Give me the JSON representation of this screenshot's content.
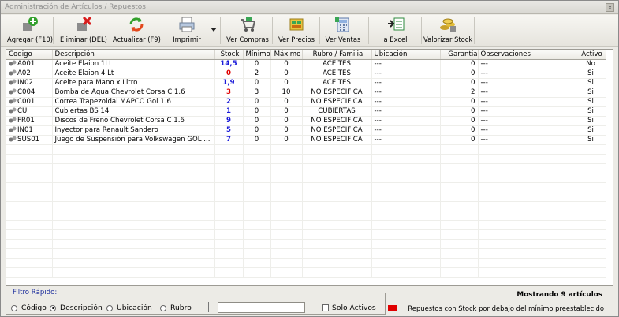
{
  "window": {
    "title": "Administración de Artículos / Repuestos",
    "close": "x"
  },
  "toolbar": {
    "add": "Agregar (F10)",
    "delete": "Eliminar (DEL)",
    "refresh": "Actualizar (F9)",
    "print": "Imprimir",
    "purchases": "Ver Compras",
    "prices": "Ver Precios",
    "sales": "Ver Ventas",
    "excel": "a Excel",
    "stock": "Valorizar Stock"
  },
  "table": {
    "headers": [
      "Codigo",
      "Descripción",
      "Stock",
      "Mínimo",
      "Máximo",
      "Rubro / Familia",
      "Ubicación",
      "Garantia",
      "Observaciones",
      "Activo"
    ],
    "rows": [
      {
        "code": "A001",
        "desc": "Aceite Elaion 1Lt",
        "stock": "14,5",
        "stock_color": "#1a1ad8",
        "min": "0",
        "max": "0",
        "rubro": "ACEITES",
        "ubic": "---",
        "gar": "0",
        "obs": "---",
        "activo": "No"
      },
      {
        "code": "A02",
        "desc": "Aceite Elaion 4 Lt",
        "stock": "0",
        "stock_color": "#e00000",
        "min": "2",
        "max": "0",
        "rubro": "ACEITES",
        "ubic": "---",
        "gar": "0",
        "obs": "---",
        "activo": "Si"
      },
      {
        "code": "IN02",
        "desc": "Aceite para Mano x Litro",
        "stock": "1,9",
        "stock_color": "#1a1ad8",
        "min": "0",
        "max": "0",
        "rubro": "ACEITES",
        "ubic": "---",
        "gar": "0",
        "obs": "---",
        "activo": "Si"
      },
      {
        "code": "C004",
        "desc": "Bomba de Agua Chevrolet Corsa C 1.6",
        "stock": "3",
        "stock_color": "#e00000",
        "min": "3",
        "max": "10",
        "rubro": "NO ESPECIFICA",
        "ubic": "---",
        "gar": "2",
        "obs": "---",
        "activo": "Si"
      },
      {
        "code": "C001",
        "desc": "Correa Trapezoidal MAPCO Gol 1.6",
        "stock": "2",
        "stock_color": "#1a1ad8",
        "min": "0",
        "max": "0",
        "rubro": "NO ESPECIFICA",
        "ubic": "---",
        "gar": "0",
        "obs": "---",
        "activo": "Si"
      },
      {
        "code": "CU",
        "desc": "Cubiertas BS 14",
        "stock": "1",
        "stock_color": "#1a1ad8",
        "min": "0",
        "max": "0",
        "rubro": "CUBIERTAS",
        "ubic": "---",
        "gar": "0",
        "obs": "---",
        "activo": "Si"
      },
      {
        "code": "FR01",
        "desc": "Discos de Freno Chevrolet Corsa C 1.6",
        "stock": "9",
        "stock_color": "#1a1ad8",
        "min": "0",
        "max": "0",
        "rubro": "NO ESPECIFICA",
        "ubic": "---",
        "gar": "0",
        "obs": "---",
        "activo": "Si"
      },
      {
        "code": "IN01",
        "desc": "Inyector para Renault Sandero",
        "stock": "5",
        "stock_color": "#1a1ad8",
        "min": "0",
        "max": "0",
        "rubro": "NO ESPECIFICA",
        "ubic": "---",
        "gar": "0",
        "obs": "---",
        "activo": "Si"
      },
      {
        "code": "SUS01",
        "desc": "Juego de Suspensión para Volkswagen GOL ...",
        "stock": "7",
        "stock_color": "#1a1ad8",
        "min": "0",
        "max": "0",
        "rubro": "NO ESPECIFICA",
        "ubic": "---",
        "gar": "0",
        "obs": "---",
        "activo": "Si"
      }
    ]
  },
  "filter": {
    "legend": "Filtro Rápido:",
    "options": [
      "Código",
      "Descripción",
      "Ubicación",
      "Rubro"
    ],
    "selected_index": 1,
    "search_value": "",
    "active_only_label": "Solo Activos",
    "active_only_checked": false
  },
  "status": {
    "showing": "Mostrando 9 artículos",
    "legend_text": "Repuestos con Stock por debajo del mínimo preestablecido",
    "legend_color": "#e00000"
  },
  "icons": [
    "add-icon",
    "delete-icon",
    "refresh-icon",
    "print-icon",
    "dropdown-arrow-icon",
    "cart-icon",
    "price-icon",
    "calculator-icon",
    "excel-icon",
    "coins-icon",
    "item-icon"
  ]
}
